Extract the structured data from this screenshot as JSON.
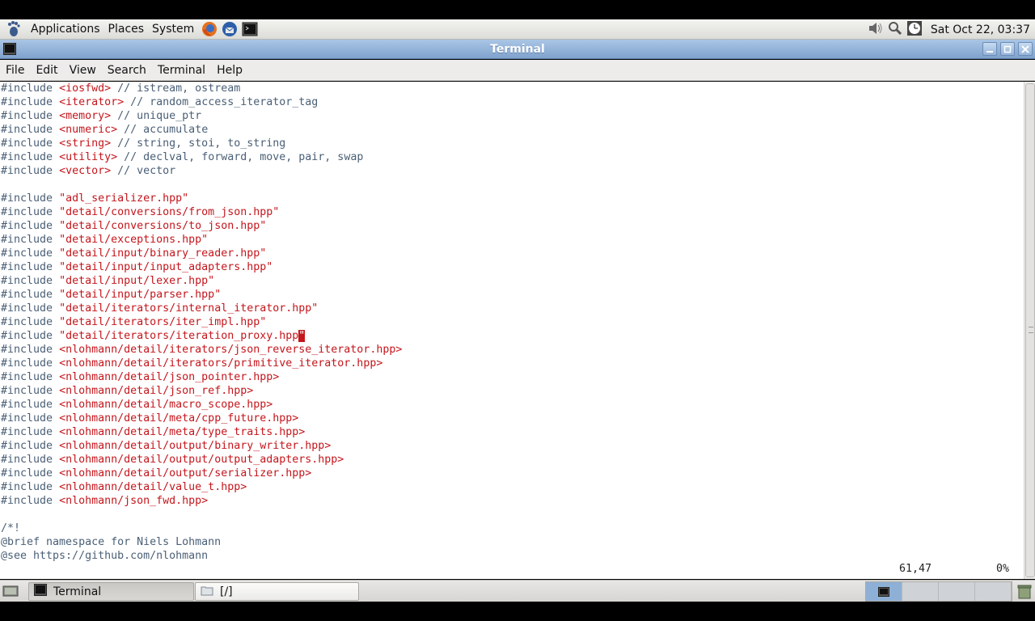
{
  "top_panel": {
    "menus": [
      "Applications",
      "Places",
      "System"
    ],
    "clock": "Sat Oct 22, 03:37"
  },
  "window": {
    "title": "Terminal"
  },
  "menubar": [
    "File",
    "Edit",
    "View",
    "Search",
    "Terminal",
    "Help"
  ],
  "terminal": {
    "lines": [
      {
        "pre": "#include ",
        "inc": "<iosfwd>",
        "com": " // istream, ostream"
      },
      {
        "pre": "#include ",
        "inc": "<iterator>",
        "com": " // random_access_iterator_tag"
      },
      {
        "pre": "#include ",
        "inc": "<memory>",
        "com": " // unique_ptr"
      },
      {
        "pre": "#include ",
        "inc": "<numeric>",
        "com": " // accumulate"
      },
      {
        "pre": "#include ",
        "inc": "<string>",
        "com": " // string, stoi, to_string"
      },
      {
        "pre": "#include ",
        "inc": "<utility>",
        "com": " // declval, forward, move, pair, swap"
      },
      {
        "pre": "#include ",
        "inc": "<vector>",
        "com": " // vector"
      },
      {
        "pre": "",
        "inc": "",
        "com": ""
      },
      {
        "pre": "#include ",
        "inc": "\"adl_serializer.hpp\"",
        "com": ""
      },
      {
        "pre": "#include ",
        "inc": "\"detail/conversions/from_json.hpp\"",
        "com": ""
      },
      {
        "pre": "#include ",
        "inc": "\"detail/conversions/to_json.hpp\"",
        "com": ""
      },
      {
        "pre": "#include ",
        "inc": "\"detail/exceptions.hpp\"",
        "com": ""
      },
      {
        "pre": "#include ",
        "inc": "\"detail/input/binary_reader.hpp\"",
        "com": ""
      },
      {
        "pre": "#include ",
        "inc": "\"detail/input/input_adapters.hpp\"",
        "com": ""
      },
      {
        "pre": "#include ",
        "inc": "\"detail/input/lexer.hpp\"",
        "com": ""
      },
      {
        "pre": "#include ",
        "inc": "\"detail/input/parser.hpp\"",
        "com": ""
      },
      {
        "pre": "#include ",
        "inc": "\"detail/iterators/internal_iterator.hpp\"",
        "com": ""
      },
      {
        "pre": "#include ",
        "inc": "\"detail/iterators/iter_impl.hpp\"",
        "com": ""
      },
      {
        "pre": "#include ",
        "inc": "\"detail/iterators/iteration_proxy.hpp",
        "com": "",
        "cursor": "\""
      },
      {
        "pre": "#include ",
        "inc": "<nlohmann/detail/iterators/json_reverse_iterator.hpp>",
        "com": ""
      },
      {
        "pre": "#include ",
        "inc": "<nlohmann/detail/iterators/primitive_iterator.hpp>",
        "com": ""
      },
      {
        "pre": "#include ",
        "inc": "<nlohmann/detail/json_pointer.hpp>",
        "com": ""
      },
      {
        "pre": "#include ",
        "inc": "<nlohmann/detail/json_ref.hpp>",
        "com": ""
      },
      {
        "pre": "#include ",
        "inc": "<nlohmann/detail/macro_scope.hpp>",
        "com": ""
      },
      {
        "pre": "#include ",
        "inc": "<nlohmann/detail/meta/cpp_future.hpp>",
        "com": ""
      },
      {
        "pre": "#include ",
        "inc": "<nlohmann/detail/meta/type_traits.hpp>",
        "com": ""
      },
      {
        "pre": "#include ",
        "inc": "<nlohmann/detail/output/binary_writer.hpp>",
        "com": ""
      },
      {
        "pre": "#include ",
        "inc": "<nlohmann/detail/output/output_adapters.hpp>",
        "com": ""
      },
      {
        "pre": "#include ",
        "inc": "<nlohmann/detail/output/serializer.hpp>",
        "com": ""
      },
      {
        "pre": "#include ",
        "inc": "<nlohmann/detail/value_t.hpp>",
        "com": ""
      },
      {
        "pre": "#include ",
        "inc": "<nlohmann/json_fwd.hpp>",
        "com": ""
      },
      {
        "pre": "",
        "inc": "",
        "com": ""
      },
      {
        "pre": "/*!",
        "inc": "",
        "com": ""
      },
      {
        "pre": "@brief namespace for Niels Lohmann",
        "inc": "",
        "com": ""
      },
      {
        "pre": "@see https://github.com/nlohmann",
        "inc": "",
        "com": ""
      }
    ],
    "status_position": "61,47",
    "status_percent": "0%"
  },
  "taskbar": {
    "tasks": [
      "Terminal",
      "[/]"
    ]
  },
  "colors": {
    "include_color": "#c4161c",
    "text_color": "#4a5f76",
    "titlebar": "#8fb0d6"
  }
}
